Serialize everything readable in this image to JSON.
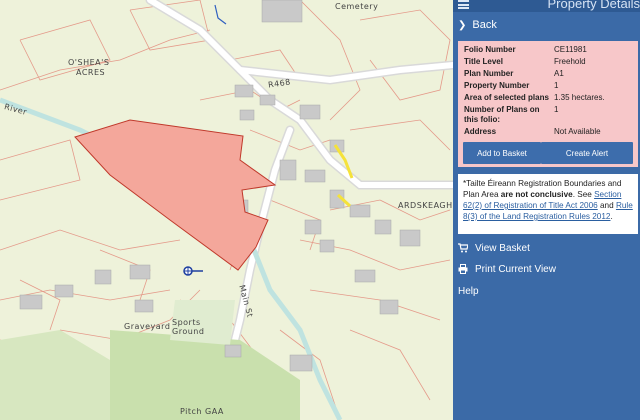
{
  "map": {
    "labels": {
      "cemetery": "Cemetery",
      "osheas": "O'SHEA'S",
      "acres": "ACRES",
      "road": "R468",
      "river": "River",
      "ardskeagh": "ARDSKEAGH",
      "main_st": "Main St",
      "graveyard": "Graveyard",
      "sports": "Sports",
      "ground": "Ground",
      "pitch": "Pitch GAA"
    },
    "selected_color": "#f4a79b"
  },
  "panel": {
    "header_title": "Property Details",
    "back_label": "Back",
    "details": [
      {
        "key": "Folio Number",
        "value": "CE11981"
      },
      {
        "key": "Title Level",
        "value": "Freehold"
      },
      {
        "key": "Plan Number",
        "value": "A1"
      },
      {
        "key": "Property Number",
        "value": "1"
      },
      {
        "key": "Area of selected plans",
        "value": "1.35 hectares."
      },
      {
        "key": "Number of Plans on this folio:",
        "value": "1"
      },
      {
        "key": "Address",
        "value": "Not Available"
      }
    ],
    "add_basket": "Add to Basket",
    "create_alert": "Create Alert",
    "note": {
      "t1": "*Tailte Éireann Registration Boundaries and Plan Area ",
      "bold": "are not conclusive",
      "t2": ". See ",
      "link1": "Section 62(2) of Registration of Title Act 2006",
      "t3": " and ",
      "link2": "Rule 8(3) of the Land Registration Rules 2012",
      "t4": "."
    },
    "menu": {
      "view_basket": "View Basket",
      "print": "Print Current View",
      "help": "Help"
    }
  }
}
